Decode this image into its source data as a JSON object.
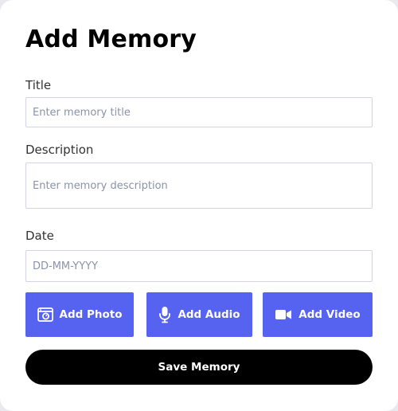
{
  "form": {
    "heading": "Add Memory",
    "title_label": "Title",
    "title_placeholder": "Enter memory title",
    "description_label": "Description",
    "description_placeholder": "Enter memory description",
    "date_label": "Date",
    "date_placeholder": "DD-MM-YYYY"
  },
  "media_buttons": {
    "photo_label": "Add Photo",
    "audio_label": "Add Audio",
    "video_label": "Add Video"
  },
  "save_label": "Save Memory",
  "icons": {
    "photo": "photo-camera-icon",
    "audio": "microphone-icon",
    "video": "video-camera-icon"
  },
  "colors": {
    "accent": "#5563f0",
    "save_button": "#000000",
    "field_border": "#d3d3e6"
  }
}
